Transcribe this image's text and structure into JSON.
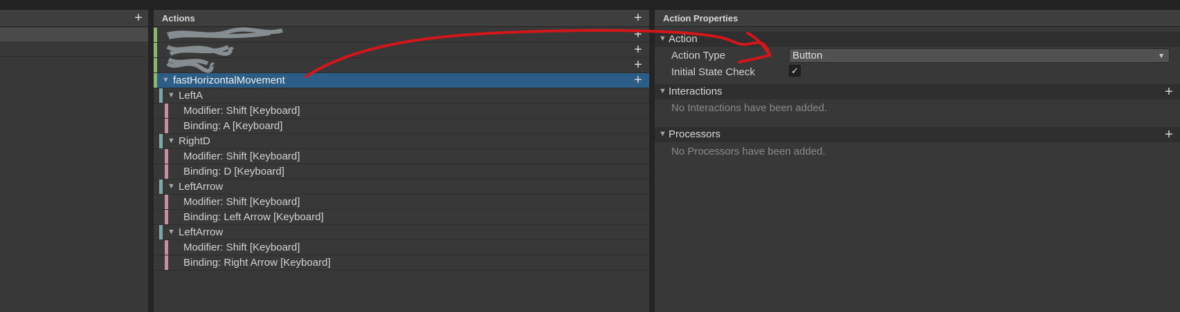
{
  "left_panel": {
    "add_label": "+"
  },
  "actions_panel": {
    "title": "Actions",
    "add_label": "+",
    "row_add_label": "+",
    "rows": [
      {
        "label": "",
        "kind": "action"
      },
      {
        "label": "",
        "kind": "action"
      },
      {
        "label": "",
        "kind": "action"
      },
      {
        "label": "fastHorizontalMovement",
        "kind": "action"
      },
      {
        "label": "LeftA",
        "kind": "composite"
      },
      {
        "label": "Modifier: Shift [Keyboard]",
        "kind": "binding"
      },
      {
        "label": "Binding: A [Keyboard]",
        "kind": "binding"
      },
      {
        "label": "RightD",
        "kind": "composite"
      },
      {
        "label": "Modifier: Shift [Keyboard]",
        "kind": "binding"
      },
      {
        "label": "Binding: D [Keyboard]",
        "kind": "binding"
      },
      {
        "label": "LeftArrow",
        "kind": "composite"
      },
      {
        "label": "Modifier: Shift [Keyboard]",
        "kind": "binding"
      },
      {
        "label": "Binding: Left Arrow [Keyboard]",
        "kind": "binding"
      },
      {
        "label": "LeftArrow",
        "kind": "composite"
      },
      {
        "label": "Modifier: Shift [Keyboard]",
        "kind": "binding"
      },
      {
        "label": "Binding: Right Arrow [Keyboard]",
        "kind": "binding"
      }
    ]
  },
  "properties_panel": {
    "title": "Action Properties",
    "action_section": {
      "title": "Action",
      "action_type_label": "Action Type",
      "action_type_value": "Button",
      "initial_state_label": "Initial State Check",
      "initial_state_checked": true,
      "check_glyph": "✓"
    },
    "interactions_section": {
      "title": "Interactions",
      "add_label": "+",
      "empty_text": "No Interactions have been added."
    },
    "processors_section": {
      "title": "Processors",
      "add_label": "+",
      "empty_text": "No Processors have been added."
    }
  },
  "colors": {
    "selection": "#2c5d87",
    "action_marker": "#8db56d",
    "composite_marker": "#7fa7a7",
    "binding_marker": "#c58ea5",
    "annotation": "#d4161b"
  }
}
